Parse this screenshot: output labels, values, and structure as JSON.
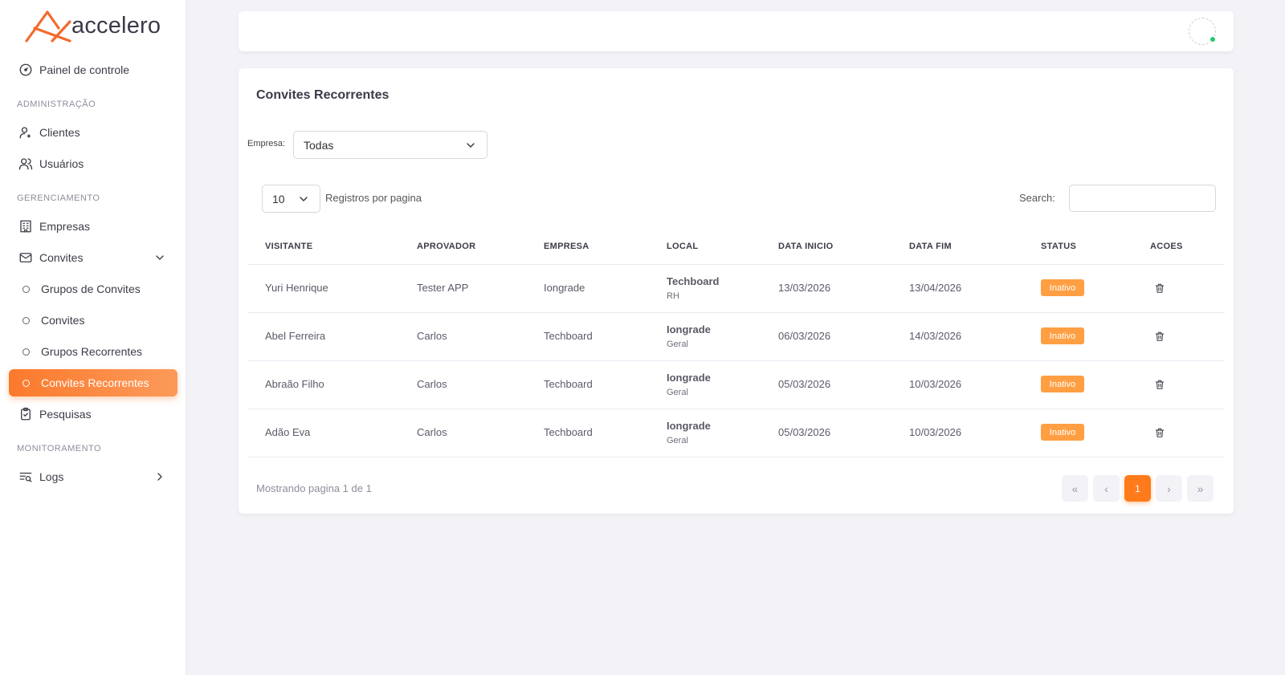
{
  "brand": {
    "name": "accelero",
    "accent": "#fb7a2c"
  },
  "sidebar": {
    "sections": {
      "admin": "ADMINISTRAÇÃO",
      "manage": "GERENCIAMENTO",
      "monitor": "MONITORAMENTO"
    },
    "items": [
      {
        "label": "Painel de controle",
        "icon": "dashboard-icon"
      },
      {
        "label": "Clientes",
        "icon": "user-icon"
      },
      {
        "label": "Usuários",
        "icon": "users-icon"
      },
      {
        "label": "Empresas",
        "icon": "building-icon"
      },
      {
        "label": "Convites",
        "icon": "mail-icon"
      },
      {
        "label": "Grupos de Convites",
        "icon": "circle-icon"
      },
      {
        "label": "Convites",
        "icon": "circle-icon"
      },
      {
        "label": "Grupos Recorrentes",
        "icon": "circle-icon"
      },
      {
        "label": "Convites Recorrentes",
        "icon": "circle-icon"
      },
      {
        "label": "Pesquisas",
        "icon": "clipboard-icon"
      },
      {
        "label": "Logs",
        "icon": "logs-icon"
      }
    ],
    "active": "Convites Recorrentes"
  },
  "page": {
    "title": "Convites Recorrentes",
    "filter_label": "Empresa:",
    "filter_value": "Todas",
    "per_page": "10",
    "per_page_label": "Registros por pagina",
    "search_label": "Search:",
    "search_value": ""
  },
  "table": {
    "columns": [
      "VISITANTE",
      "APROVADOR",
      "EMPRESA",
      "LOCAL",
      "DATA INICIO",
      "DATA FIM",
      "STATUS",
      "ACOES"
    ],
    "rows": [
      {
        "visitante": "Yuri Henrique",
        "aprovador": "Tester APP",
        "empresa": "Iongrade",
        "local": "Techboard",
        "local_sub": "RH",
        "inicio": "13/03/2026",
        "fim": "13/04/2026",
        "status": "Inativo"
      },
      {
        "visitante": "Abel Ferreira",
        "aprovador": "Carlos",
        "empresa": "Techboard",
        "local": "Iongrade",
        "local_sub": "Geral",
        "inicio": "06/03/2026",
        "fim": "14/03/2026",
        "status": "Inativo"
      },
      {
        "visitante": "Abraão Filho",
        "aprovador": "Carlos",
        "empresa": "Techboard",
        "local": "Iongrade",
        "local_sub": "Geral",
        "inicio": "05/03/2026",
        "fim": "10/03/2026",
        "status": "Inativo"
      },
      {
        "visitante": "Adão Eva",
        "aprovador": "Carlos",
        "empresa": "Techboard",
        "local": "Iongrade",
        "local_sub": "Geral",
        "inicio": "05/03/2026",
        "fim": "10/03/2026",
        "status": "Inativo"
      }
    ],
    "status_color": "#ff9f43"
  },
  "pagination": {
    "info": "Mostrando pagina 1 de 1",
    "first": "«",
    "prev": "‹",
    "current": "1",
    "next": "›",
    "last": "»"
  }
}
